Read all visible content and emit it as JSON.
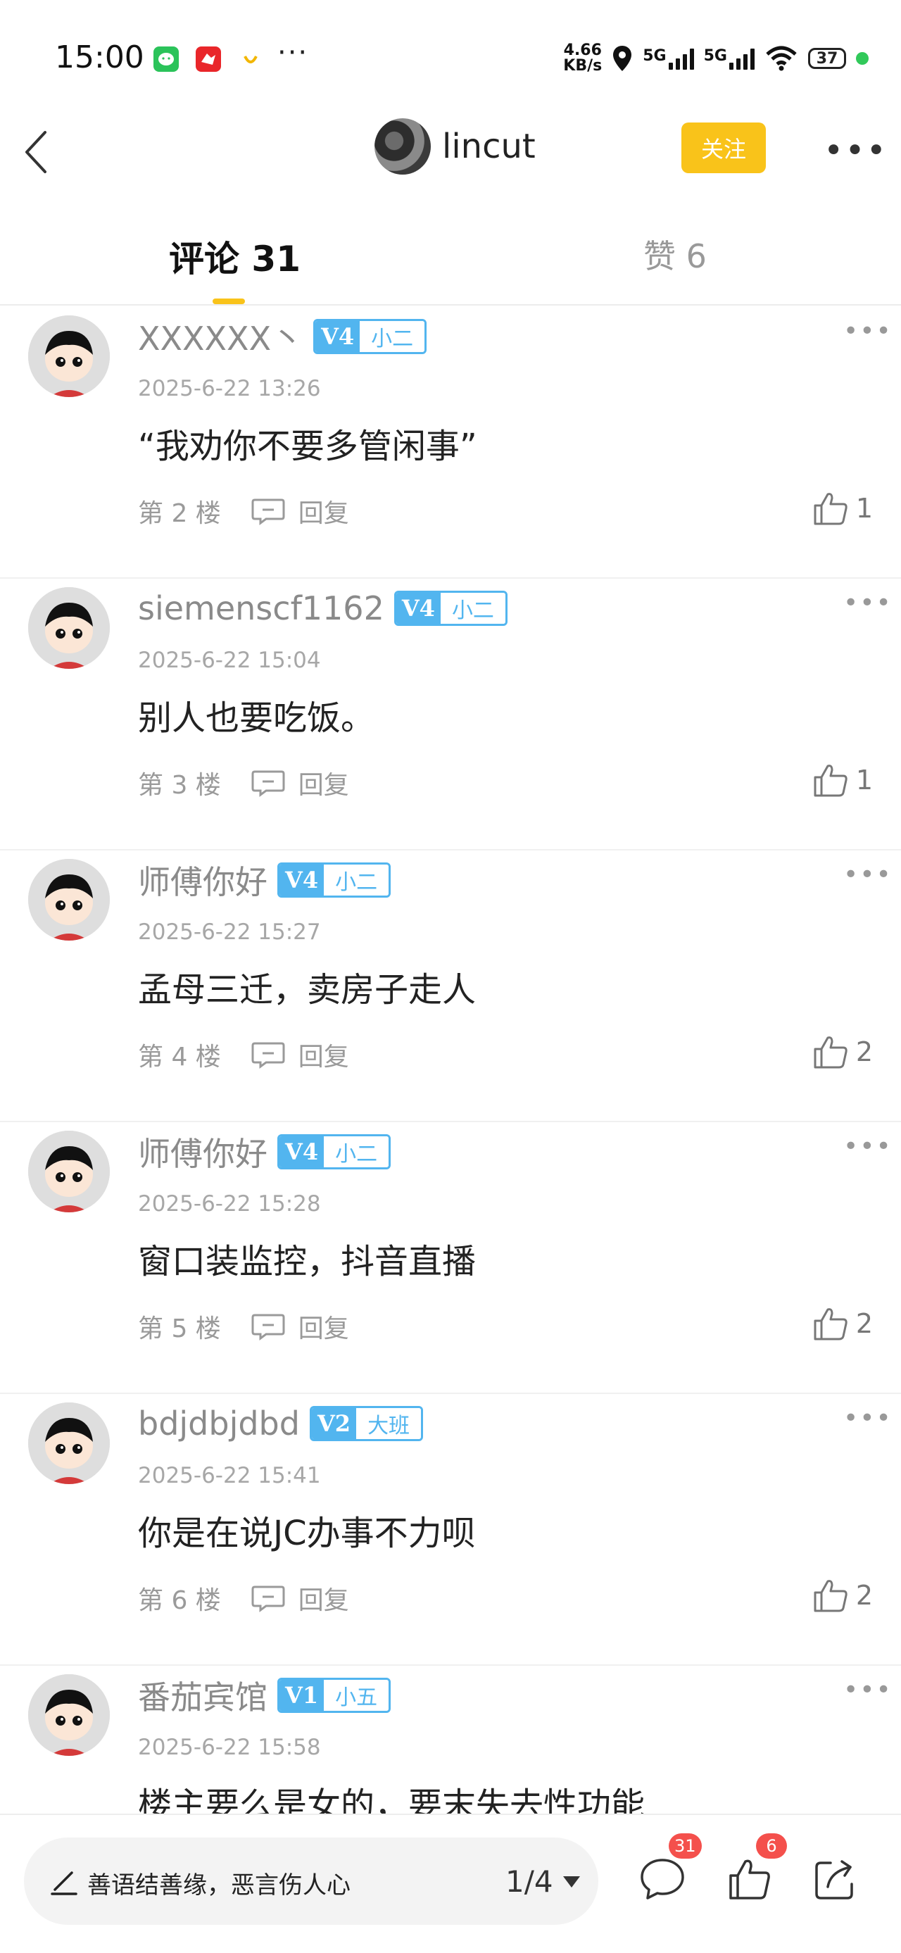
{
  "status": {
    "time": "15:00",
    "net_speed_value": "4.66",
    "net_speed_unit": "KB/s",
    "sim1": "5G",
    "sim2": "5G",
    "battery": "37"
  },
  "header": {
    "username": "lincut",
    "follow_label": "关注"
  },
  "tabs": {
    "comments_label": "评论 31",
    "likes_label": "赞 6"
  },
  "comments": [
    {
      "name": "XXXXXX丶",
      "level": "V4",
      "title": "小二",
      "time": "2025-6-22 13:26",
      "text": "“我劝你不要多管闲事”",
      "floor": "第 2 楼",
      "reply": "回复",
      "likes": "1"
    },
    {
      "name": "siemenscf1162",
      "level": "V4",
      "title": "小二",
      "time": "2025-6-22 15:04",
      "text": "别人也要吃饭。",
      "floor": "第 3 楼",
      "reply": "回复",
      "likes": "1"
    },
    {
      "name": "师傅你好",
      "level": "V4",
      "title": "小二",
      "time": "2025-6-22 15:27",
      "text": "孟母三迁，卖房子走人",
      "floor": "第 4 楼",
      "reply": "回复",
      "likes": "2"
    },
    {
      "name": "师傅你好",
      "level": "V4",
      "title": "小二",
      "time": "2025-6-22 15:28",
      "text": "窗口装监控，抖音直播",
      "floor": "第 5 楼",
      "reply": "回复",
      "likes": "2"
    },
    {
      "name": "bdjdbjdbd",
      "level": "V2",
      "title": "大班",
      "time": "2025-6-22 15:41",
      "text": "你是在说JC办事不力呗",
      "floor": "第 6 楼",
      "reply": "回复",
      "likes": "2"
    },
    {
      "name": "番茄宾馆",
      "level": "V1",
      "title": "小五",
      "time": "2025-6-22 15:58",
      "text": "楼主要么是女的，要末失去性功能",
      "floor": "",
      "reply": "",
      "likes": ""
    }
  ],
  "bottom": {
    "input_placeholder": "善语结善缘，恶言伤人心",
    "page_indicator": "1/4",
    "comment_count": "31",
    "like_count": "6"
  }
}
